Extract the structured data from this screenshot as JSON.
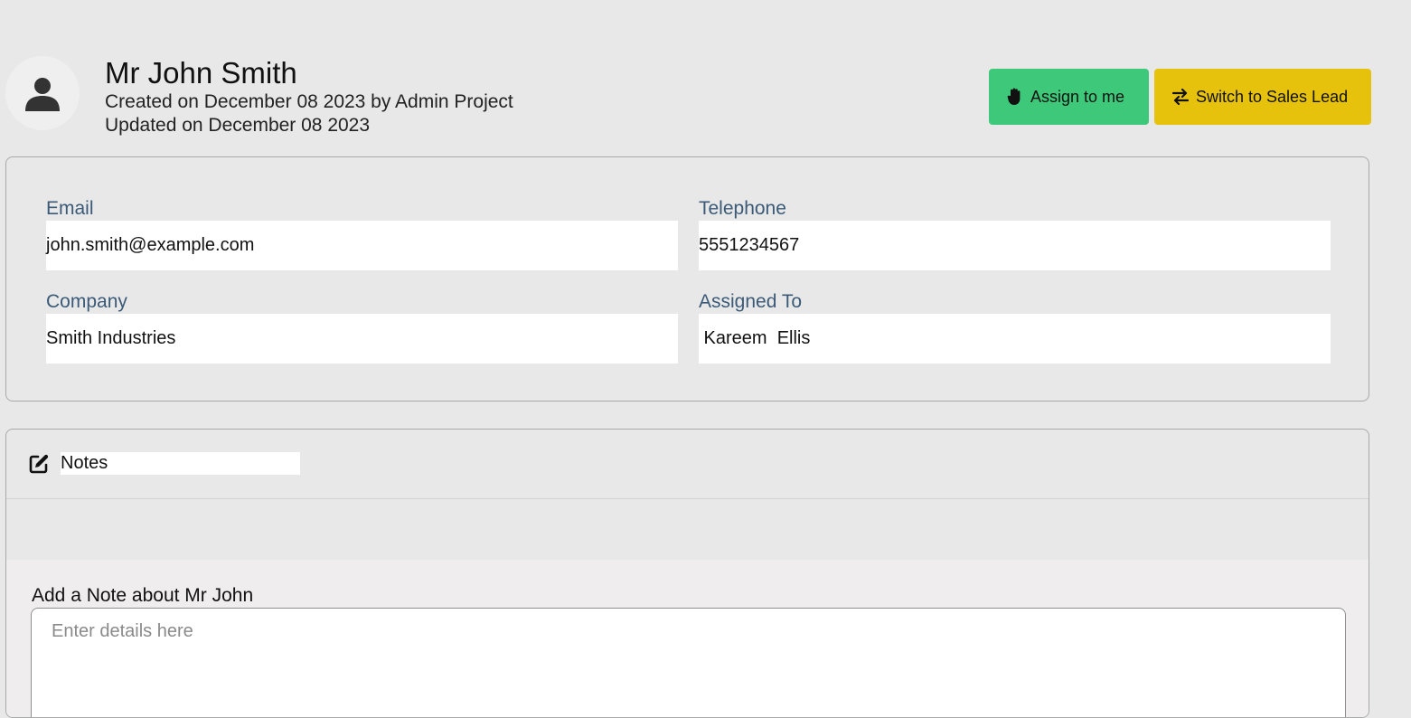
{
  "lead": {
    "name": "Mr John Smith",
    "created": "Created on December 08 2023 by Admin Project",
    "updated": "Updated on December 08 2023"
  },
  "actions": {
    "assign_label": "Assign to me",
    "switch_label": "Switch to Sales Lead",
    "assign_icon": "hand-icon",
    "switch_icon": "swap-arrows-icon",
    "assign_color": "#3ec97a",
    "switch_color": "#e7c20d"
  },
  "fields": {
    "email": {
      "label": "Email",
      "value": "john.smith@example.com"
    },
    "telephone": {
      "label": "Telephone",
      "value": "5551234567"
    },
    "company": {
      "label": "Company",
      "value": "Smith Industries"
    },
    "assigned_to": {
      "label": "Assigned To",
      "value": " Kareem  Ellis"
    }
  },
  "notes": {
    "title": "Notes",
    "icon": "edit-icon",
    "add_label": "Add a Note about Mr John",
    "placeholder": "Enter details here"
  }
}
